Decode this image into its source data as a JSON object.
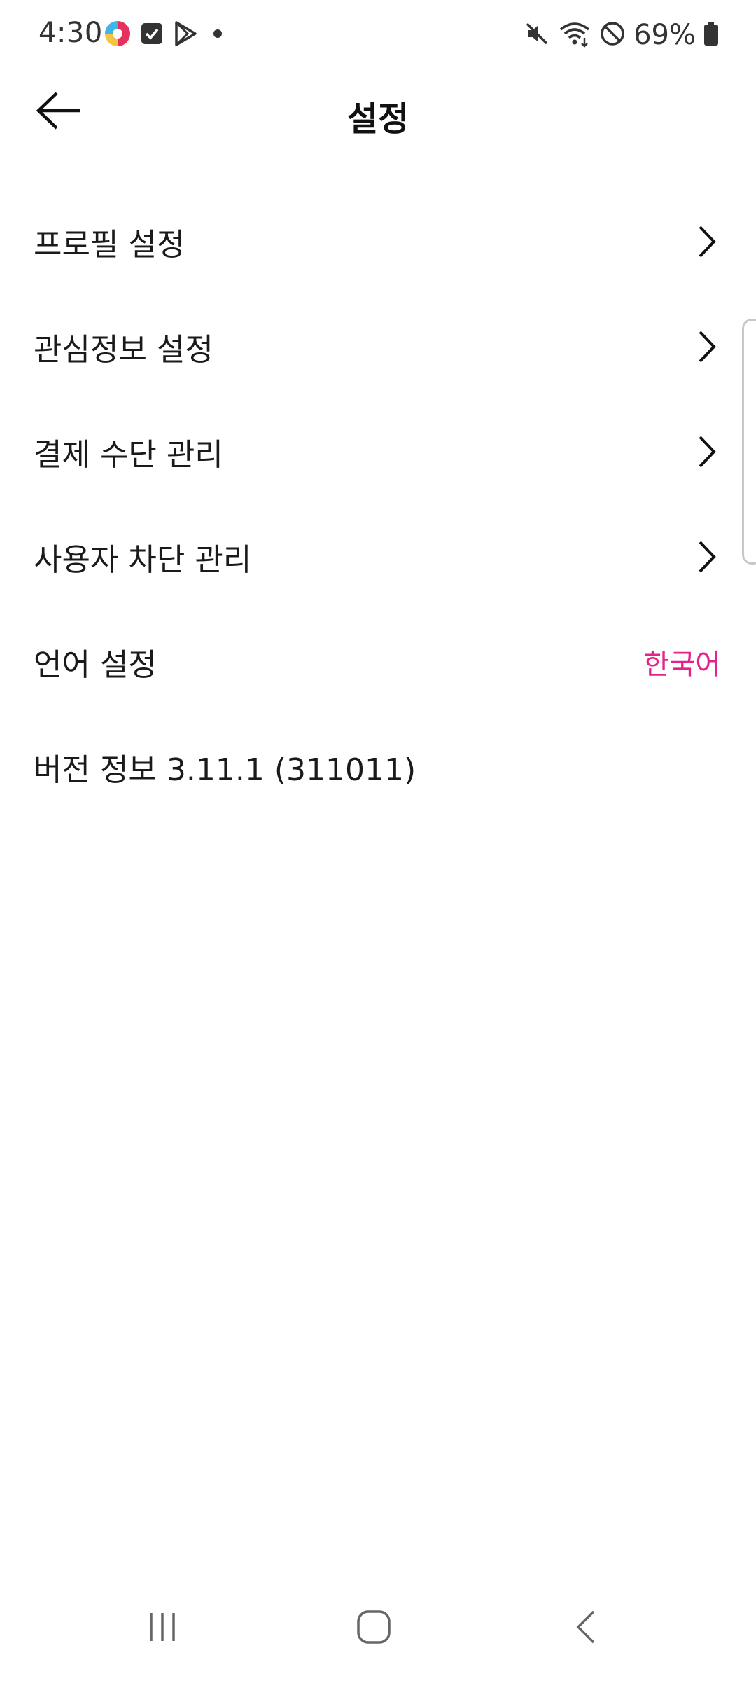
{
  "status_bar": {
    "time": "4:30",
    "battery": "69%",
    "icons_left": [
      "app-notification-icon",
      "checkbox-icon",
      "play-store-icon",
      "dot-icon"
    ],
    "icons_right": [
      "mute-icon",
      "wifi-icon",
      "do-not-disturb-icon",
      "battery-icon"
    ]
  },
  "header": {
    "title": "설정",
    "back_icon": "arrow-left-icon"
  },
  "menu": {
    "items": [
      {
        "label": "프로필 설정",
        "icon": "chevron-right-icon"
      },
      {
        "label": "관심정보 설정",
        "icon": "chevron-right-icon"
      },
      {
        "label": "결제 수단 관리",
        "icon": "chevron-right-icon"
      },
      {
        "label": "사용자 차단 관리",
        "icon": "chevron-right-icon"
      },
      {
        "label": "언어 설정",
        "value": "한국어"
      },
      {
        "label": "버전 정보 3.11.1 (311011)"
      }
    ]
  },
  "colors": {
    "accent": "#e5218a",
    "text": "#1a1a1a",
    "background": "#ffffff"
  },
  "nav_bar": {
    "icons": [
      "recent-apps-icon",
      "home-icon",
      "back-icon"
    ]
  }
}
